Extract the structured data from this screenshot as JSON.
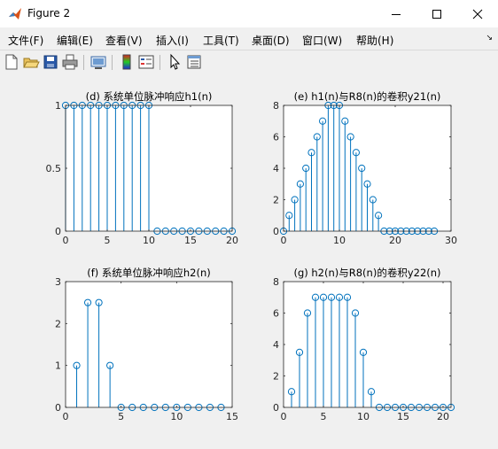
{
  "window": {
    "title": "Figure 2"
  },
  "menu": [
    "文件(F)",
    "编辑(E)",
    "查看(V)",
    "插入(I)",
    "工具(T)",
    "桌面(D)",
    "窗口(W)",
    "帮助(H)"
  ],
  "colors": {
    "stem": "#0072bd",
    "axes_bg": "#ffffff",
    "figure_bg": "#f0f0f0"
  },
  "chart_data": [
    {
      "type": "stem",
      "title": "(d) 系统单位脉冲响应h1(n)",
      "xlabel": "",
      "ylabel": "",
      "xlim": [
        0,
        20
      ],
      "ylim": [
        0,
        1
      ],
      "xticks": [
        0,
        5,
        10,
        15,
        20
      ],
      "yticks": [
        0,
        0.5,
        1
      ],
      "x": [
        0,
        1,
        2,
        3,
        4,
        5,
        6,
        7,
        8,
        9,
        10,
        11,
        12,
        13,
        14,
        15,
        16,
        17,
        18,
        19,
        20
      ],
      "y": [
        1,
        1,
        1,
        1,
        1,
        1,
        1,
        1,
        1,
        1,
        1,
        0,
        0,
        0,
        0,
        0,
        0,
        0,
        0,
        0,
        0
      ]
    },
    {
      "type": "stem",
      "title": "(e) h1(n)与R8(n)的卷积y21(n)",
      "xlabel": "",
      "ylabel": "",
      "xlim": [
        0,
        30
      ],
      "ylim": [
        0,
        8
      ],
      "xticks": [
        0,
        10,
        20,
        30
      ],
      "yticks": [
        0,
        2,
        4,
        6,
        8
      ],
      "x": [
        0,
        1,
        2,
        3,
        4,
        5,
        6,
        7,
        8,
        9,
        10,
        11,
        12,
        13,
        14,
        15,
        16,
        17,
        18,
        19,
        20,
        21,
        22,
        23,
        24,
        25,
        26,
        27
      ],
      "y": [
        0,
        1,
        2,
        3,
        4,
        5,
        6,
        7,
        8,
        8,
        8,
        7,
        6,
        5,
        4,
        3,
        2,
        1,
        0,
        0,
        0,
        0,
        0,
        0,
        0,
        0,
        0,
        0
      ]
    },
    {
      "type": "stem",
      "title": "(f) 系统单位脉冲响应h2(n)",
      "xlabel": "",
      "ylabel": "",
      "xlim": [
        0,
        15
      ],
      "ylim": [
        0,
        3
      ],
      "xticks": [
        0,
        5,
        10,
        15
      ],
      "yticks": [
        0,
        1,
        2,
        3
      ],
      "x": [
        1,
        2,
        3,
        4,
        5,
        6,
        7,
        8,
        9,
        10,
        11,
        12,
        13,
        14
      ],
      "y": [
        1,
        2.5,
        2.5,
        1,
        0,
        0,
        0,
        0,
        0,
        0,
        0,
        0,
        0,
        0
      ]
    },
    {
      "type": "stem",
      "title": "(g) h2(n)与R8(n)的卷积y22(n)",
      "xlabel": "",
      "ylabel": "",
      "xlim": [
        0,
        21
      ],
      "ylim": [
        0,
        8
      ],
      "xticks": [
        0,
        5,
        10,
        15,
        20
      ],
      "yticks": [
        0,
        2,
        4,
        6,
        8
      ],
      "x": [
        1,
        2,
        3,
        4,
        5,
        6,
        7,
        8,
        9,
        10,
        11,
        12,
        13,
        14,
        15,
        16,
        17,
        18,
        19,
        20,
        21
      ],
      "y": [
        1,
        3.5,
        6,
        7,
        7,
        7,
        7,
        7,
        6,
        3.5,
        1,
        0,
        0,
        0,
        0,
        0,
        0,
        0,
        0,
        0,
        0
      ]
    }
  ]
}
